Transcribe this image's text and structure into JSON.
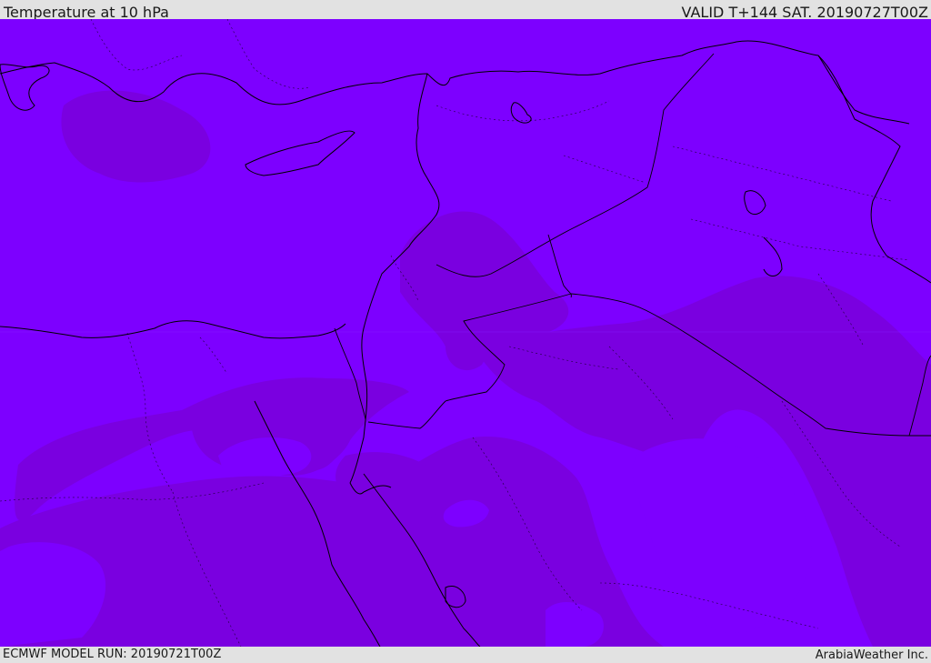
{
  "header": {
    "title": "Temperature at 10 hPa",
    "valid": "VALID T+144 SAT. 20190727T00Z"
  },
  "footer": {
    "model_run": "ECMWF MODEL RUN: 20190721T00Z",
    "credit": "ArabiaWeather Inc."
  },
  "map": {
    "field_colors": {
      "base": "#7d00ff",
      "warm_band": "#7a00e0"
    },
    "line_color": "#000000"
  }
}
